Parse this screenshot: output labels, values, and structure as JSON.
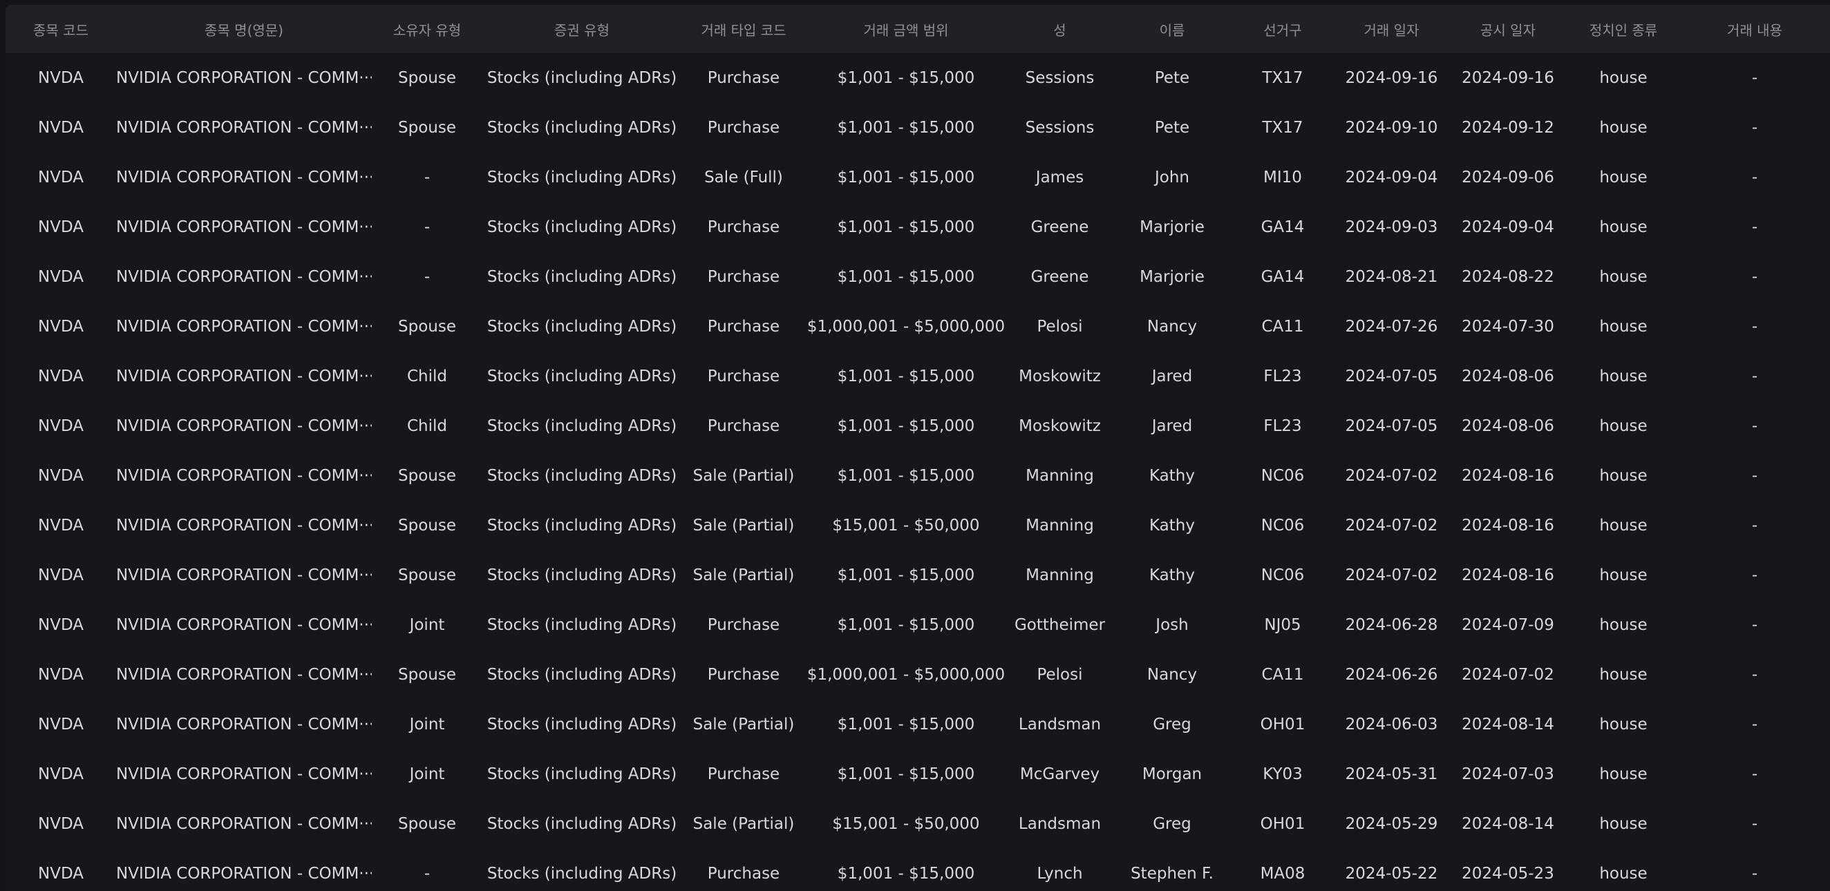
{
  "table": {
    "columns": [
      "종목 코드",
      "종목 명(영문)",
      "소유자 유형",
      "증권 유형",
      "거래 타입 코드",
      "거래 금액 범위",
      "성",
      "이름",
      "선거구",
      "거래 일자",
      "공시 일자",
      "정치인 종류",
      "거래 내용"
    ],
    "rows": [
      [
        "NVDA",
        "NVIDIA CORPORATION - COMM···",
        "Spouse",
        "Stocks (including ADRs)",
        "Purchase",
        "$1,001 - $15,000",
        "Sessions",
        "Pete",
        "TX17",
        "2024-09-16",
        "2024-09-16",
        "house",
        "-"
      ],
      [
        "NVDA",
        "NVIDIA CORPORATION - COMM···",
        "Spouse",
        "Stocks (including ADRs)",
        "Purchase",
        "$1,001 - $15,000",
        "Sessions",
        "Pete",
        "TX17",
        "2024-09-10",
        "2024-09-12",
        "house",
        "-"
      ],
      [
        "NVDA",
        "NVIDIA CORPORATION - COMM···",
        "-",
        "Stocks (including ADRs)",
        "Sale (Full)",
        "$1,001 - $15,000",
        "James",
        "John",
        "MI10",
        "2024-09-04",
        "2024-09-06",
        "house",
        "-"
      ],
      [
        "NVDA",
        "NVIDIA CORPORATION - COMM···",
        "-",
        "Stocks (including ADRs)",
        "Purchase",
        "$1,001 - $15,000",
        "Greene",
        "Marjorie",
        "GA14",
        "2024-09-03",
        "2024-09-04",
        "house",
        "-"
      ],
      [
        "NVDA",
        "NVIDIA CORPORATION - COMM···",
        "-",
        "Stocks (including ADRs)",
        "Purchase",
        "$1,001 - $15,000",
        "Greene",
        "Marjorie",
        "GA14",
        "2024-08-21",
        "2024-08-22",
        "house",
        "-"
      ],
      [
        "NVDA",
        "NVIDIA CORPORATION - COMM···",
        "Spouse",
        "Stocks (including ADRs)",
        "Purchase",
        "$1,000,001 - $5,000,000",
        "Pelosi",
        "Nancy",
        "CA11",
        "2024-07-26",
        "2024-07-30",
        "house",
        "-"
      ],
      [
        "NVDA",
        "NVIDIA CORPORATION - COMM···",
        "Child",
        "Stocks (including ADRs)",
        "Purchase",
        "$1,001 - $15,000",
        "Moskowitz",
        "Jared",
        "FL23",
        "2024-07-05",
        "2024-08-06",
        "house",
        "-"
      ],
      [
        "NVDA",
        "NVIDIA CORPORATION - COMM···",
        "Child",
        "Stocks (including ADRs)",
        "Purchase",
        "$1,001 - $15,000",
        "Moskowitz",
        "Jared",
        "FL23",
        "2024-07-05",
        "2024-08-06",
        "house",
        "-"
      ],
      [
        "NVDA",
        "NVIDIA CORPORATION - COMM···",
        "Spouse",
        "Stocks (including ADRs)",
        "Sale (Partial)",
        "$1,001 - $15,000",
        "Manning",
        "Kathy",
        "NC06",
        "2024-07-02",
        "2024-08-16",
        "house",
        "-"
      ],
      [
        "NVDA",
        "NVIDIA CORPORATION - COMM···",
        "Spouse",
        "Stocks (including ADRs)",
        "Sale (Partial)",
        "$15,001 - $50,000",
        "Manning",
        "Kathy",
        "NC06",
        "2024-07-02",
        "2024-08-16",
        "house",
        "-"
      ],
      [
        "NVDA",
        "NVIDIA CORPORATION - COMM···",
        "Spouse",
        "Stocks (including ADRs)",
        "Sale (Partial)",
        "$1,001 - $15,000",
        "Manning",
        "Kathy",
        "NC06",
        "2024-07-02",
        "2024-08-16",
        "house",
        "-"
      ],
      [
        "NVDA",
        "NVIDIA CORPORATION - COMM···",
        "Joint",
        "Stocks (including ADRs)",
        "Purchase",
        "$1,001 - $15,000",
        "Gottheimer",
        "Josh",
        "NJ05",
        "2024-06-28",
        "2024-07-09",
        "house",
        "-"
      ],
      [
        "NVDA",
        "NVIDIA CORPORATION - COMM···",
        "Spouse",
        "Stocks (including ADRs)",
        "Purchase",
        "$1,000,001 - $5,000,000",
        "Pelosi",
        "Nancy",
        "CA11",
        "2024-06-26",
        "2024-07-02",
        "house",
        "-"
      ],
      [
        "NVDA",
        "NVIDIA CORPORATION - COMM···",
        "Joint",
        "Stocks (including ADRs)",
        "Sale (Partial)",
        "$1,001 - $15,000",
        "Landsman",
        "Greg",
        "OH01",
        "2024-06-03",
        "2024-08-14",
        "house",
        "-"
      ],
      [
        "NVDA",
        "NVIDIA CORPORATION - COMM···",
        "Joint",
        "Stocks (including ADRs)",
        "Purchase",
        "$1,001 - $15,000",
        "McGarvey",
        "Morgan",
        "KY03",
        "2024-05-31",
        "2024-07-03",
        "house",
        "-"
      ],
      [
        "NVDA",
        "NVIDIA CORPORATION - COMM···",
        "Spouse",
        "Stocks (including ADRs)",
        "Sale (Partial)",
        "$15,001 - $50,000",
        "Landsman",
        "Greg",
        "OH01",
        "2024-05-29",
        "2024-08-14",
        "house",
        "-"
      ],
      [
        "NVDA",
        "NVIDIA CORPORATION - COMM···",
        "-",
        "Stocks (including ADRs)",
        "Purchase",
        "$1,001 - $15,000",
        "Lynch",
        "Stephen F.",
        "MA08",
        "2024-05-22",
        "2024-05-23",
        "house",
        "-"
      ]
    ]
  }
}
